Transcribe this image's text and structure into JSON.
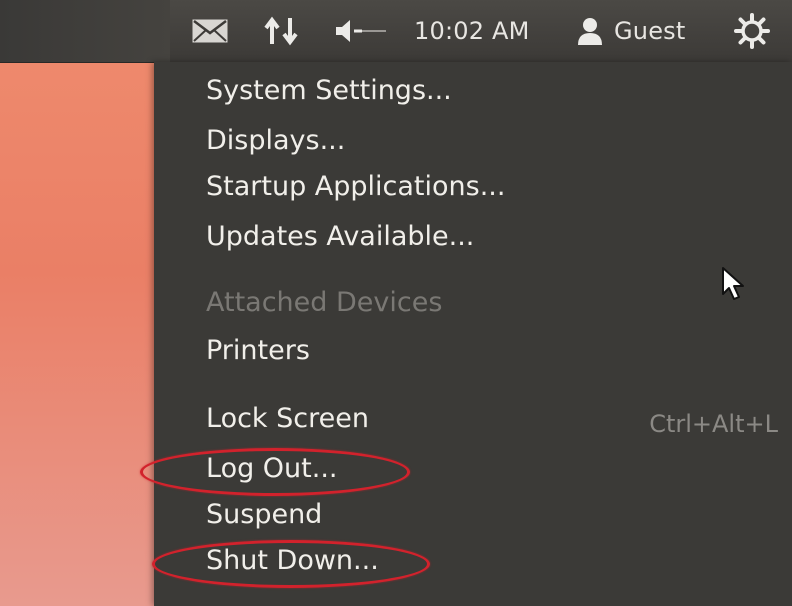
{
  "topbar": {
    "icons": {
      "mail": "envelope-icon",
      "network": "network-updown-icon",
      "sound": "speaker-icon",
      "user": "person-icon",
      "session": "gear-icon"
    },
    "clock": "10:02 AM",
    "user_name": "Guest"
  },
  "menu": {
    "items": [
      {
        "label": "System Settings..."
      },
      {
        "label": "Displays..."
      },
      {
        "label": "Startup Applications..."
      },
      {
        "label": "Updates Available..."
      },
      {
        "label": "Attached Devices"
      },
      {
        "label": "Printers"
      },
      {
        "label": "Lock Screen",
        "shortcut": "Ctrl+Alt+L"
      },
      {
        "label": "Log Out..."
      },
      {
        "label": "Suspend"
      },
      {
        "label": "Shut Down..."
      }
    ]
  },
  "annotations": {
    "highlight_color": "#d2222c",
    "highlighted_items": [
      "Log Out...",
      "Shut Down..."
    ]
  }
}
